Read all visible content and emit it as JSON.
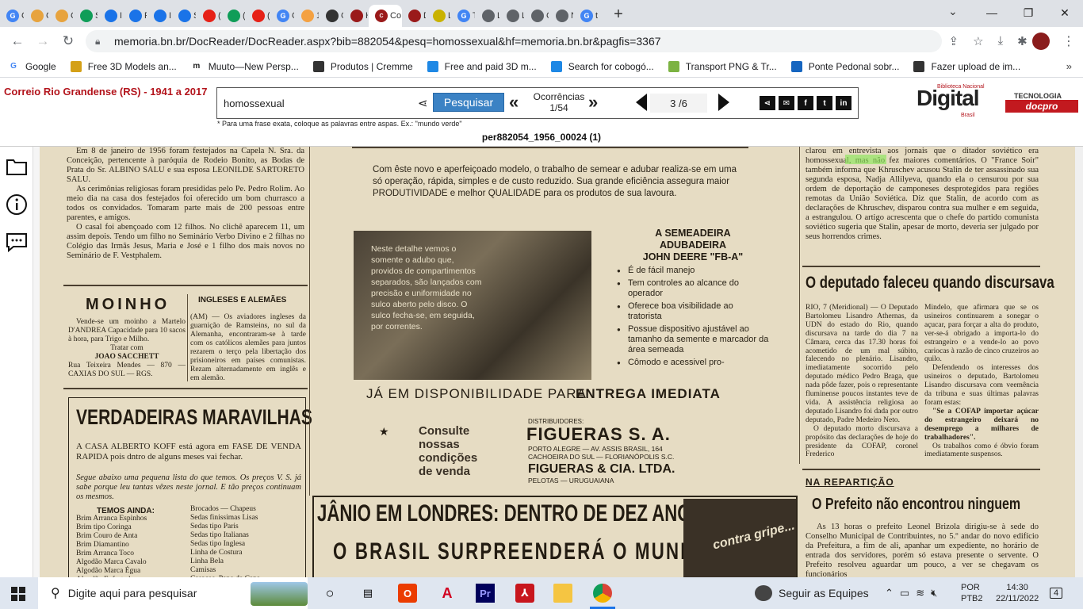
{
  "browser": {
    "tabs": [
      {
        "letter": "G",
        "label": "G",
        "color": "#4285f4"
      },
      {
        "letter": "",
        "label": "C",
        "color": "#e7a33e"
      },
      {
        "letter": "",
        "label": "C",
        "color": "#e7a33e"
      },
      {
        "letter": "",
        "label": "S",
        "color": "#0f9d58"
      },
      {
        "letter": "",
        "label": "Ir",
        "color": "#1a73e8"
      },
      {
        "letter": "",
        "label": "R",
        "color": "#1a73e8"
      },
      {
        "letter": "",
        "label": "Ir",
        "color": "#1a73e8"
      },
      {
        "letter": "",
        "label": "S",
        "color": "#1a73e8"
      },
      {
        "letter": "",
        "label": "(",
        "color": "#e62117"
      },
      {
        "letter": "",
        "label": "(",
        "color": "#0f9d58"
      },
      {
        "letter": "",
        "label": "(",
        "color": "#e62117"
      },
      {
        "letter": "G",
        "label": "C",
        "color": "#4285f4"
      },
      {
        "letter": "",
        "label": "1",
        "color": "#f4a142"
      },
      {
        "letter": "",
        "label": "C",
        "color": "#333333"
      },
      {
        "letter": "",
        "label": "H",
        "color": "#9a1a1a"
      }
    ],
    "active_tab_label": "Co",
    "tabs_after": [
      {
        "letter": "",
        "label": "D",
        "color": "#9a1a1a"
      },
      {
        "letter": "",
        "label": "L",
        "color": "#c9b200"
      },
      {
        "letter": "G",
        "label": "T",
        "color": "#4285f4"
      },
      {
        "letter": "",
        "label": "L",
        "color": "#5f6368"
      },
      {
        "letter": "",
        "label": "L",
        "color": "#5f6368"
      },
      {
        "letter": "",
        "label": "C",
        "color": "#5f6368"
      },
      {
        "letter": "",
        "label": "N",
        "color": "#5f6368"
      },
      {
        "letter": "G",
        "label": "t",
        "color": "#4285f4"
      }
    ],
    "new_tab": "+",
    "url": "memoria.bn.br/DocReader/DocReader.aspx?bib=882054&pesq=homossexual&hf=memoria.bn.br&pagfis=3367",
    "bookmarks": [
      {
        "label": "Google",
        "icon": "G",
        "color": "#4285f4"
      },
      {
        "label": "Free 3D Models an...",
        "icon": "",
        "color": "#d4a017"
      },
      {
        "label": "Muuto—New Persp...",
        "icon": "m",
        "color": "#222222"
      },
      {
        "label": "Produtos | Cremme",
        "icon": "",
        "color": "#333333"
      },
      {
        "label": "Free and paid 3D m...",
        "icon": "",
        "color": "#1e88e5"
      },
      {
        "label": "Search for cobogó...",
        "icon": "",
        "color": "#1e88e5"
      },
      {
        "label": "Transport PNG & Tr...",
        "icon": "",
        "color": "#7cb342"
      },
      {
        "label": "Ponte Pedonal sobr...",
        "icon": "",
        "color": "#1565c0"
      },
      {
        "label": "Fazer upload de im...",
        "icon": "",
        "color": "#333333"
      }
    ],
    "bookmarks_more": "»"
  },
  "site": {
    "title": "Correio Rio Grandense (RS) - 1941 a 2017",
    "search_value": "homossexual",
    "search_button": "Pesquisar",
    "occurrences_label": "Ocorrências",
    "occurrences_value": "1/54",
    "page_value": "3 /6",
    "hint": "* Para uma frase exata, coloque as palavras entre aspas. Ex.: \"mundo verde\"",
    "page_name": "per882054_1956_00024 (1)",
    "logo_main": "Digital",
    "logo_top": "Biblioteca Nacional",
    "logo_brasil": "Brasil",
    "logo_tec": "TECNOLOGIA",
    "logo_docpro": "docpro"
  },
  "newspaper": {
    "left_col_1": "Em 8 de janeiro de 1956 foram festejados na Capela N. Sra. da Conceição, pertencente à paróquia de Rodeio Bonito, as Bodas de Prata do Sr. ALBINO SALU e sua esposa LEONILDE SARTORETO SALU.",
    "left_col_2": "As cerimônias religiosas foram presididas pelo Pe. Pedro Rolim. Ao meio dia na casa dos festejados foi oferecido um bom churrasco a todos os convidados. Tomaram parte mais de 200 pessoas entre parentes, e amigos.",
    "left_col_3": "O casal foi abençoado com 12 filhos. No clichê aparecem 11, um assim depois. Tendo um filho no Seminário Verbo Divino e 2 filhas no Colégio das Irmãs Jesus, Maria e José e 1 filho dos mais novos no Seminário de F. Vestphalem.",
    "moinho_title": "MOINHO",
    "moinho_text": "Vende-se um moinho a Martelo D'ANDREA Capacidade para 10 sacos à hora, para Trigo e Milho.",
    "moinho_tratar": "Tratar com",
    "moinho_name": "JOAO SACCHETT",
    "moinho_addr": "Rua Teixeira Mendes — 870 — CAXIAS DO SUL — RGS.",
    "ingleses_title": "INGLESES E ALEMÃES",
    "ingleses_text": "(AM) — Os aviadores ingleses da guarnição de Ramsteins, no sul da Alemanha, encontraram-se à tarde com os católicos alemães para juntos rezarem o terço pela libertação dos prisioneiros em países comunistas. Rezam alternadamente em inglês e em alemão.",
    "verdadeiras_title": "VERDADEIRAS MARAVILHAS",
    "verdadeiras_text_1": "A CASA ALBERTO KOFF está agora em FASE DE VENDA RAPIDA pois dntro de alguns meses vai fechar.",
    "verdadeiras_text_2": "Segue abaixo uma pequena lista do que temos. Os preços V. S. já sabe porque leu tantas vêzes neste jornal. E tão preços continuam os mesmos.",
    "temos_ainda": "TEMOS AINDA:",
    "temos_left": "Brim Arranca Espinhos\nBrim tipo Coringa\nBrim Couro de Anta\nBrim Diamantino\nBrim Arranca Toco\nAlgodão Marca Cavalo\nAlgodão Marca Égua\nAlgodão Enfestado",
    "temos_right": "Brocados — Chapeus\nSedas finissimas Lisas\nSedas tipo Paris\nSedas tipo Italianas\nSedas tipo Inglesa\nLinha de Costura\nLinha Bela\nCamisas\nCasacos, Pano de Capa",
    "ad_intro": "Com êste novo e aperfeiçoado modelo, o trabalho de semear e adubar realiza-se em uma só operação, rápida, simples e de custo reduzido. Sua grande eficiência assegura maior PRODUTIVIDADE e melhor QUALIDADE para os produtos de sua lavoura.",
    "ad_img_text": "Neste detalhe vemos o somente o adubo que, providos de compartimentos separados, são lançados com precisão e uniformidade no sulco aberto pelo disco. O sulco fecha-se, em seguida, por correntes.",
    "ad_title": "A SEMEADEIRA\nADUBADEIRA\nJOHN DEERE \"FB-A\"",
    "ad_bullets": [
      "É de fácil manejo",
      "Tem controles ao alcance do operador",
      "Oferece boa visibilidade ao tratorista",
      "Possue dispositivo ajustável ao tamanho da semente e marcador da área semeada",
      "Cômodo e acessivel pro-"
    ],
    "ad_disponib_1": "JÁ EM DISPONIBILIDADE PARA",
    "ad_disponib_2": "ENTREGA IMEDIATA",
    "ad_consulte": "Consulte\nnossas\ncondições\nde venda",
    "ad_distrib": "DISTRIBUIDORES:",
    "ad_figueras": "FIGUERAS S. A.",
    "ad_figueras_addr": "PORTO ALEGRE — AV. ASSIS BRASIL, 164\nCACHOEIRA DO SUL — FLORIANÓPOLIS S.C.",
    "ad_figueras_2": "FIGUERAS & CIA. LTDA.",
    "ad_figueras_2_addr": "PELOTAS — URUGUAIANA",
    "janio_1": "JÂNIO EM LONDRES: DENTRO DE DEZ ANOS",
    "janio_2": "O BRASIL SURPREENDERÁ O MUNDO",
    "gripe": "contra gripe...",
    "right_col_1": "clarou em entrevista aos jornais que o ditador soviético era homossexual, mas não fez maiores comentários. O \"France Soir\" também informa que Khruschev acusou Stalin de ter assassinado sua segunda esposa, Nadja Allilyeva, quando ela o censurou por sua ordem de deportação de camponeses desprotegidos para regiões remotas da União Soviética. Diz que Stalin, de acordo com as declarações de Khruschev, disparou contra sua mulher e em seguida, a estrangulou. O artigo acrescenta que o chefe do partido comunista soviético sugeria que Stalin, apesar de morto, deveria ser julgado por seus horrendos crimes.",
    "deputado_title": "O deputado faleceu quando discursava",
    "deputado_a": "RIO, 7 (Meridional) — O Deputado Bartolomeu Lisandro Athernas, da UDN do estado do Rio, quando discursava na tarde do dia 7 na Câmara, cerca das 17.30 horas foi acometido de um mal súbito, falecendo no plenário. Lisandro, imediatamente socorrido pelo deputado médico Pedro Braga, que nada pôde fazer, pois o representante fluminense poucos instantes teve de vida. A assistência religiosa ao deputado Lisandro foi dada por outro deputado, Padre Medeiro Neto.",
    "deputado_a2": "O deputado morto discursava a propósito das declarações de hoje do presidente da COFAP, coronel Frederico",
    "deputado_b": "Mindelo, que afirmara que se os usineiros continuarem a sonegar o açucar, para forçar a alta do produto, ver-se-á obrigado a importa-lo do estrangeiro e a vende-lo ao povo cariocas à razão de cinco cruzeiros ao quilo.",
    "deputado_b2": "Defendendo os interesses dos usineiros o deputado, Bartolomeu Lisandro discursava com veemência da tribuna e suas últimas palavras foram estas:",
    "deputado_b3": "\"Se a COFAP importar açúcar do estrangeiro deixará no desemprego a milhares de trabalhadores\".",
    "deputado_b4": "Os trabalhos como é óbvio foram imediatamente suspensos.",
    "reparticao_kicker": "NA REPARTIÇÃO",
    "reparticao_title": "O Prefeito não encontrou ninguem",
    "reparticao_text": "As 13 horas o prefeito Leonel Brizola dirigiu-se à sede do Conselho Municipal de Contribuintes, no 5.º andar do novo edifício da Prefeitura, a fim de ali, apanhar um expediente, no horário de entrada dos servidores, porém só estava presente o servente. O Prefeito resolveu aguardar um pouco, a ver se chegavam os funcionários"
  },
  "taskbar": {
    "search_placeholder": "Digite aqui para pesquisar",
    "teams_label": "Seguir as Equipes",
    "lang_1": "POR",
    "lang_2": "PTB2",
    "time": "14:30",
    "date": "22/11/2022",
    "notif_count": "4"
  }
}
